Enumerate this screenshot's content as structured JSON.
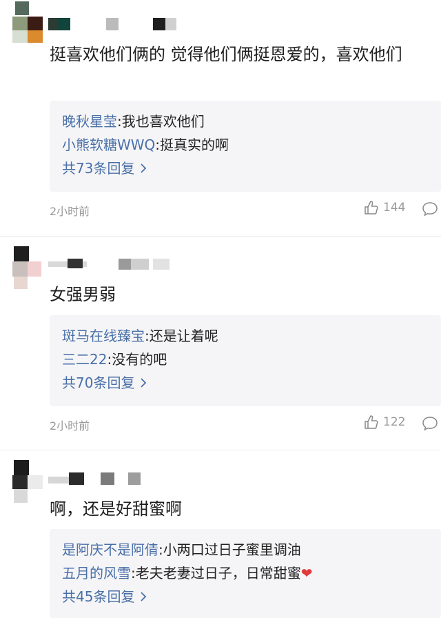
{
  "comments": [
    {
      "text": "挺喜欢他们俩的 觉得他们俩挺恩爱的，喜欢他们",
      "replies": [
        {
          "user": "晚秋星莹",
          "text": ":我也喜欢他们"
        },
        {
          "user": "小熊软糖WWQ",
          "text": ":挺真实的啊"
        }
      ],
      "more": "共73条回复",
      "time": "2小时前",
      "likes": "144"
    },
    {
      "text": "女强男弱",
      "replies": [
        {
          "user": "斑马在线臻宝",
          "text": ":还是让着呢"
        },
        {
          "user": "三二22",
          "text": ":没有的吧"
        }
      ],
      "more": "共70条回复",
      "time": "2小时前",
      "likes": "122"
    },
    {
      "text": "啊，还是好甜蜜啊",
      "replies": [
        {
          "user": "是阿庆不是阿倩",
          "text": ":小两口过日子蜜里调油"
        },
        {
          "user": "五月的风雪",
          "text": ":老夫老妻过日子，日常甜蜜"
        }
      ],
      "more": "共45条回复",
      "time": "",
      "likes": ""
    }
  ],
  "icons": {
    "like": "thumbs-up-icon",
    "reply": "comment-bubble-icon",
    "chevron": "chevron-right-icon",
    "heart": "heart-icon"
  }
}
